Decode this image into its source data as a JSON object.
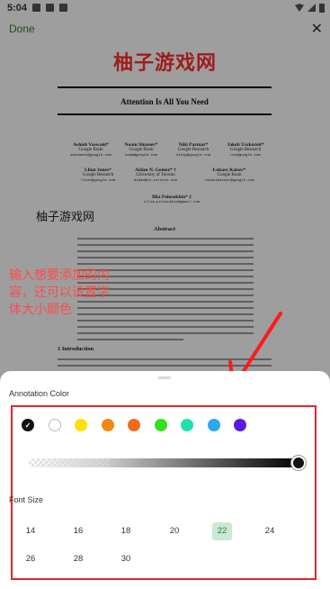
{
  "status_bar": {
    "time": "5:04"
  },
  "app_bar": {
    "done_label": "Done",
    "close_icon": "close-icon"
  },
  "document": {
    "overlay_title": "柚子游戏网",
    "title": "Attention Is All You Need",
    "authors": [
      {
        "name": "Ashish Vaswani*",
        "affiliation": "Google Brain",
        "email": "avaswani@google.com"
      },
      {
        "name": "Noam Shazeer*",
        "affiliation": "Google Brain",
        "email": "noam@google.com"
      },
      {
        "name": "Niki Parmar*",
        "affiliation": "Google Research",
        "email": "nikip@google.com"
      },
      {
        "name": "Jakob Uszkoreit*",
        "affiliation": "Google Research",
        "email": "usz@google.com"
      },
      {
        "name": "Llion Jones*",
        "affiliation": "Google Research",
        "email": "llion@google.com"
      },
      {
        "name": "Aidan N. Gomez* †",
        "affiliation": "University of Toronto",
        "email": "aidan@cs.toronto.edu"
      },
      {
        "name": "Łukasz Kaiser*",
        "affiliation": "Google Brain",
        "email": "lukaszkaiser@google.com"
      },
      {
        "name": "Illia Polosukhin* ‡",
        "affiliation": "",
        "email": "illia.polosukhin@gmail.com"
      }
    ],
    "watermark": "柚子游戏网",
    "abstract_heading": "Abstract",
    "intro_heading": "1   Introduction"
  },
  "annotation_note": "输入想要添加的内容，还可以设置字体大小颜色",
  "sheet": {
    "annotation_color_label": "Annotation Color",
    "colors": [
      "#111111",
      "#ffffff",
      "#ffe000",
      "#f08a12",
      "#f06a1c",
      "#33e01a",
      "#1de0b0",
      "#2aa8f0",
      "#5a1ae0"
    ],
    "selected_color_index": 0,
    "opacity_fraction": 1.0,
    "font_size_label": "Font Size",
    "font_sizes": [
      "14",
      "16",
      "18",
      "20",
      "22",
      "24",
      "26",
      "28",
      "30"
    ],
    "selected_font_size": "22"
  }
}
